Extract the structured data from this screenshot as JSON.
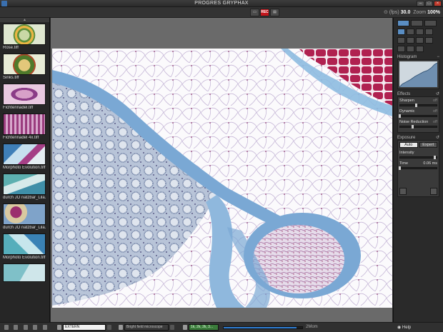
{
  "window": {
    "title": "PROGRES GRYPHAX"
  },
  "toolbar": {
    "rec_label": "REC",
    "fps_label": "(fps)",
    "fps_value": "30.0",
    "zoom_label": "Zoom",
    "zoom_value": "100%"
  },
  "thumbnails": [
    {
      "label": "Rose.tiff"
    },
    {
      "label": "Sinks.tiff"
    },
    {
      "label": "Fichtennadel.tiff"
    },
    {
      "label": "Fichtennadel 4x.tiff"
    },
    {
      "label": "Morphoto Evolution.tiff"
    },
    {
      "label": "durch JO natzbar_Lila..."
    },
    {
      "label": "durch JO natzbar_Lila..."
    },
    {
      "label": "Morphoto Evolution.tiff"
    }
  ],
  "right_panel": {
    "histogram": {
      "title": "Histogram"
    },
    "effects": {
      "title": "Effects",
      "sharpen": {
        "label": "Sharpen",
        "unit": "off",
        "level": 0.45
      },
      "dynamic": {
        "label": "Dynamic",
        "unit": "off",
        "level": 0.0
      },
      "noise": {
        "label": "Noise Reduction",
        "unit": "off",
        "level": 0.35
      }
    },
    "exposure": {
      "title": "Exposure",
      "mode_auto": "Auto",
      "mode_expert": "Expert",
      "intensity": {
        "label": "Intensity",
        "level": 0.96
      },
      "time": {
        "label": "Time",
        "value": "0.06 ms",
        "level": 0.0
      }
    }
  },
  "bottombar": {
    "profile_value": "EXTERN",
    "device_value": "Bright field microscope",
    "resolution_value": "1k, 2k, 2k, 3...",
    "progress_fraction": 0.93,
    "progress_label": "2Mom",
    "help_label": "Help"
  },
  "colors": {
    "accent": "#5a8ec4",
    "rec": "#c4161c",
    "progress": "#2f7fd6",
    "tissue_blue": "#7aa8d4",
    "tissue_red": "#b02150"
  }
}
